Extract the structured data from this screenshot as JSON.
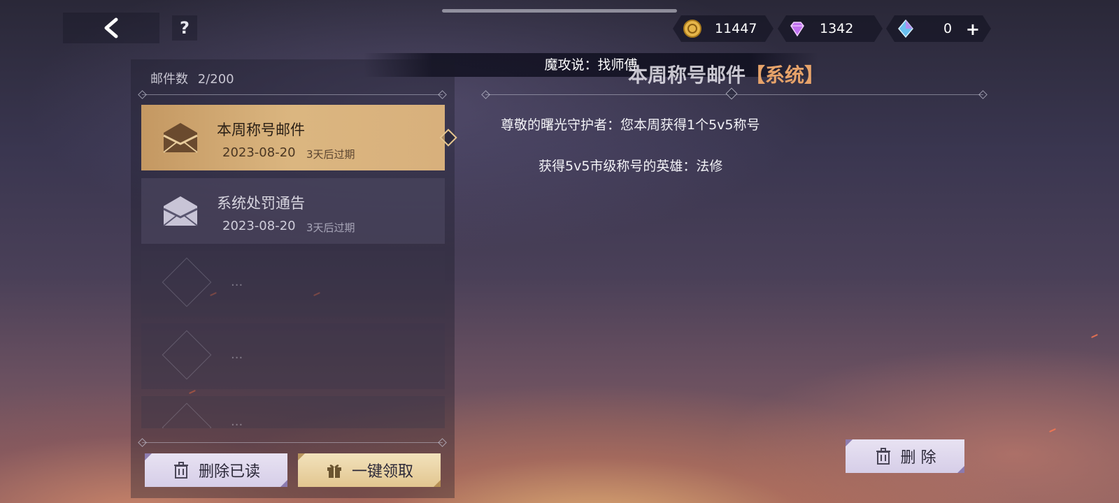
{
  "header": {
    "back_icon": "chevron-left-icon",
    "help_label": "?"
  },
  "currencies": [
    {
      "name": "gold-coin",
      "value": "11447"
    },
    {
      "name": "purple-diamond",
      "value": "1342"
    },
    {
      "name": "blue-crystal",
      "value": "0",
      "add_label": "+"
    }
  ],
  "marquee": {
    "text": "魔攻说：找师傅"
  },
  "mailbox": {
    "count_label": "邮件数",
    "count_value": "2/200",
    "items": [
      {
        "title": "本周称号邮件",
        "date": "2023-08-20",
        "expire": "3天后过期",
        "selected": true
      },
      {
        "title": "系统处罚通告",
        "date": "2023-08-20",
        "expire": "3天后过期",
        "selected": false
      }
    ],
    "empty_placeholder": "...",
    "delete_read_label": "删除已读",
    "claim_all_label": "一键领取"
  },
  "detail": {
    "title": "本周称号邮件",
    "tag": "【系统】",
    "line1": "尊敬的曙光守护者：您本周获得1个5v5称号",
    "line2": "获得5v5市级称号的英雄：法修",
    "delete_label": "删 除"
  },
  "colors": {
    "selected_mail": "#d8b07c",
    "tag_accent": "#e7a36a",
    "button_lavender": "#e0d8ee",
    "button_gold": "#ead4a4"
  }
}
